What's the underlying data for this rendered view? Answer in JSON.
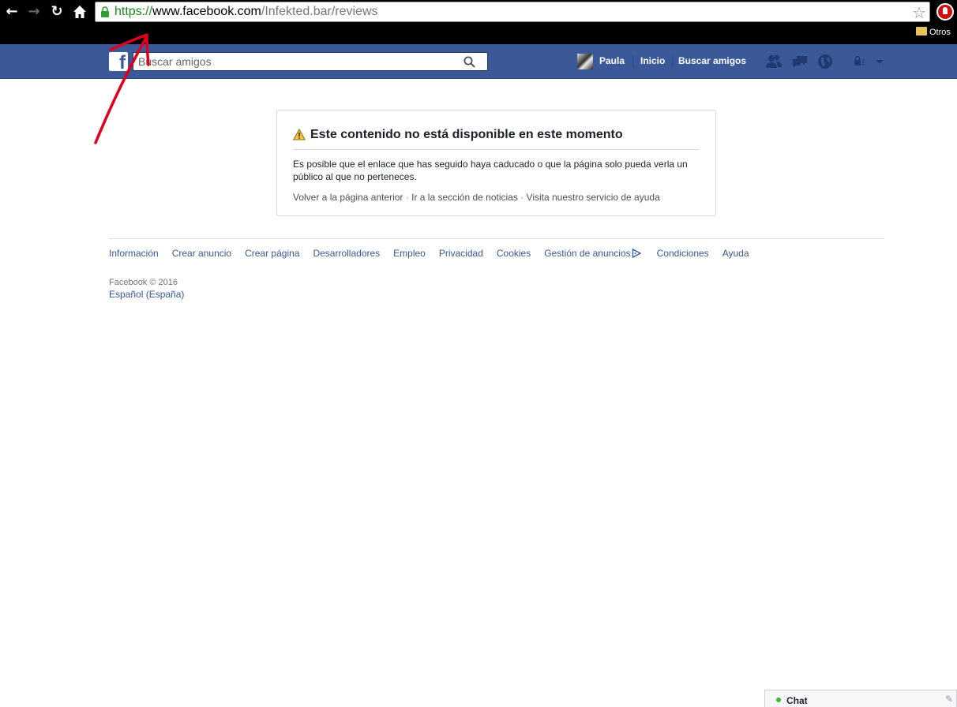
{
  "browser": {
    "url_protocol": "https://",
    "url_host": "www.facebook.com",
    "url_path": "/Infekted.bar/reviews",
    "bookmarks_folder": "Otros"
  },
  "fb": {
    "logo_letter": "f",
    "search_placeholder": "Buscar amigos",
    "user_name": "Paula",
    "nav_home": "Inicio",
    "nav_find_friends": "Buscar amigos"
  },
  "notice": {
    "title": "Este contenido no está disponible en este momento",
    "body": "Es posible que el enlace que has seguido haya caducado o que la página solo pueda verla un público al que no perteneces.",
    "links": [
      "Volver a la página anterior",
      "Ir a la sección de noticias",
      "Visita nuestro servicio de ayuda"
    ],
    "separator": " · "
  },
  "footer": {
    "links": [
      "Información",
      "Crear anuncio",
      "Crear página",
      "Desarrolladores",
      "Empleo",
      "Privacidad",
      "Cookies",
      "Gestión de anuncios",
      "Condiciones",
      "Ayuda"
    ],
    "copyright": "Facebook © 2016",
    "language": "Español (España)"
  },
  "chat": {
    "label": "Chat"
  },
  "colors": {
    "fb_blue": "#3b5998",
    "link_blue": "#365899",
    "annotation_red": "#e0001b",
    "url_green": "#1a8a1a",
    "online_green": "#42b72a"
  },
  "icons": {
    "back": "arrow-left-icon",
    "forward": "arrow-right-icon",
    "reload": "reload-icon",
    "home": "home-icon",
    "lock": "lock-icon",
    "star": "star-icon",
    "warning": "warning-icon",
    "search": "search-icon"
  }
}
